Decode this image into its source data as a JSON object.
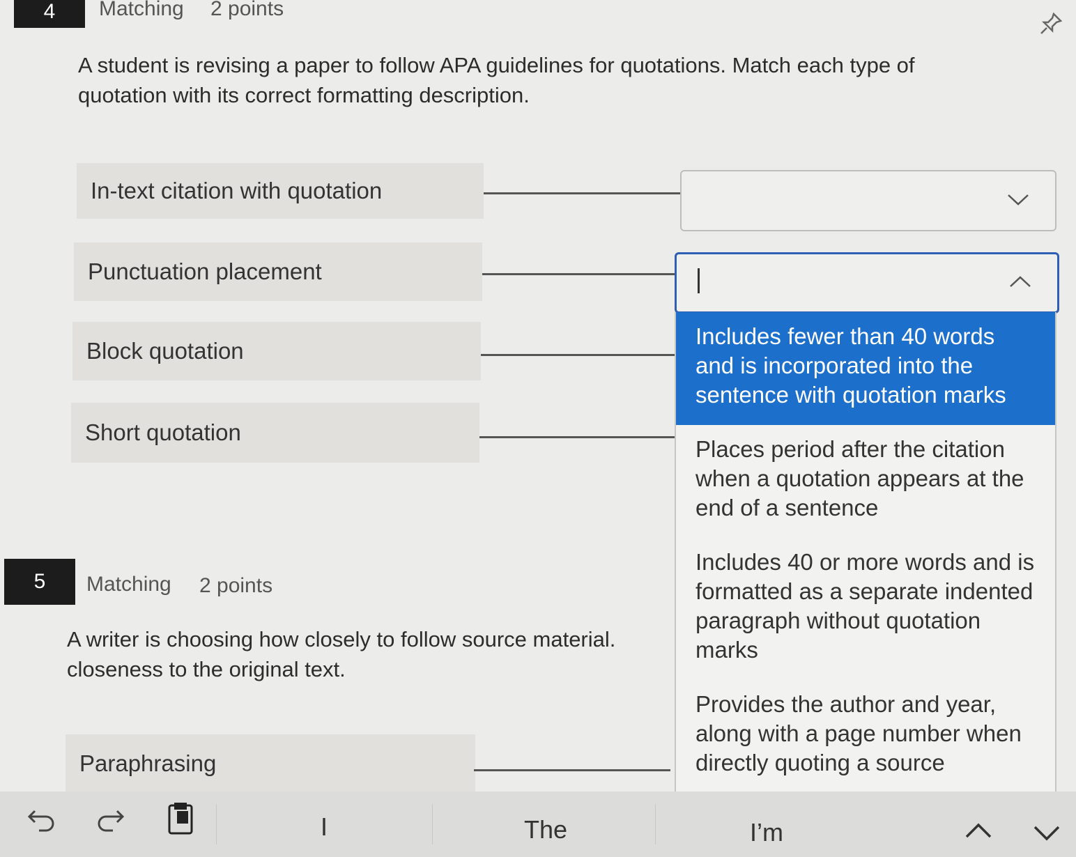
{
  "q4": {
    "number": "4",
    "type": "Matching",
    "points": "2 points",
    "prompt": "A student is revising a paper to follow APA guidelines for quotations. Match each type of quotation with its correct formatting description.",
    "terms": [
      "In-text citation with quotation",
      "Punctuation placement",
      "Block quotation",
      "Short quotation"
    ],
    "options": [
      "Includes fewer than 40 words and is incorporated into the sentence with quotation marks",
      "Places period after the citation when a quotation appears at the end of a sentence",
      "Includes 40 or more words and is formatted as a separate indented paragraph without quotation marks",
      "Provides the author and year, along with a page number when directly quoting a source"
    ]
  },
  "q5": {
    "number": "5",
    "type": "Matching",
    "points": "2 points",
    "prompt": "A writer is choosing how closely to follow source material.\ncloseness to the original text.",
    "terms": [
      "Paraphrasing"
    ]
  },
  "keyboard": {
    "suggestions": [
      "I",
      "The",
      "I’m"
    ]
  },
  "icons": {
    "pin": "pin-icon",
    "undo": "undo-icon",
    "redo": "redo-icon",
    "clipboard": "clipboard-icon",
    "chevron_up": "chevron-up-icon",
    "chevron_down": "chevron-down-icon"
  },
  "colors": {
    "selected_option": "#1d6fcc",
    "active_border": "#2f5fb5"
  }
}
